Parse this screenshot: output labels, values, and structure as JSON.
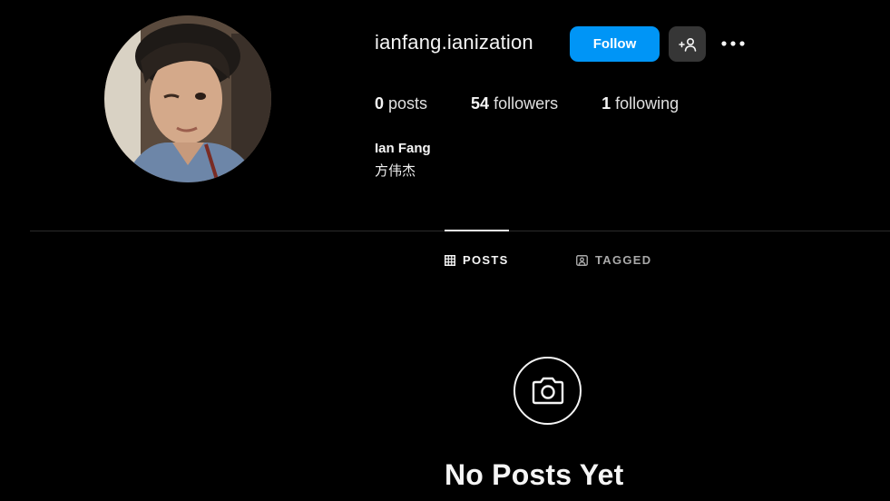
{
  "profile": {
    "username": "ianfang.ianization",
    "full_name": "Ian Fang",
    "bio": "方伟杰",
    "avatar_icon": "profile-photo"
  },
  "actions": {
    "follow_label": "Follow",
    "suggest_icon": "add-person-icon",
    "more_icon": "more-options-icon"
  },
  "stats": {
    "posts_count": "0",
    "posts_label": "posts",
    "followers_count": "54",
    "followers_label": "followers",
    "following_count": "1",
    "following_label": "following"
  },
  "tabs": [
    {
      "label": "POSTS",
      "icon": "grid-icon",
      "active": true
    },
    {
      "label": "TAGGED",
      "icon": "tagged-icon",
      "active": false
    }
  ],
  "empty_state": {
    "icon": "camera-icon",
    "title": "No Posts Yet"
  },
  "colors": {
    "background": "#000000",
    "accent": "#0095f6",
    "secondary_button": "#363636",
    "text_primary": "#f5f5f5",
    "text_secondary": "#a8a8a8"
  }
}
